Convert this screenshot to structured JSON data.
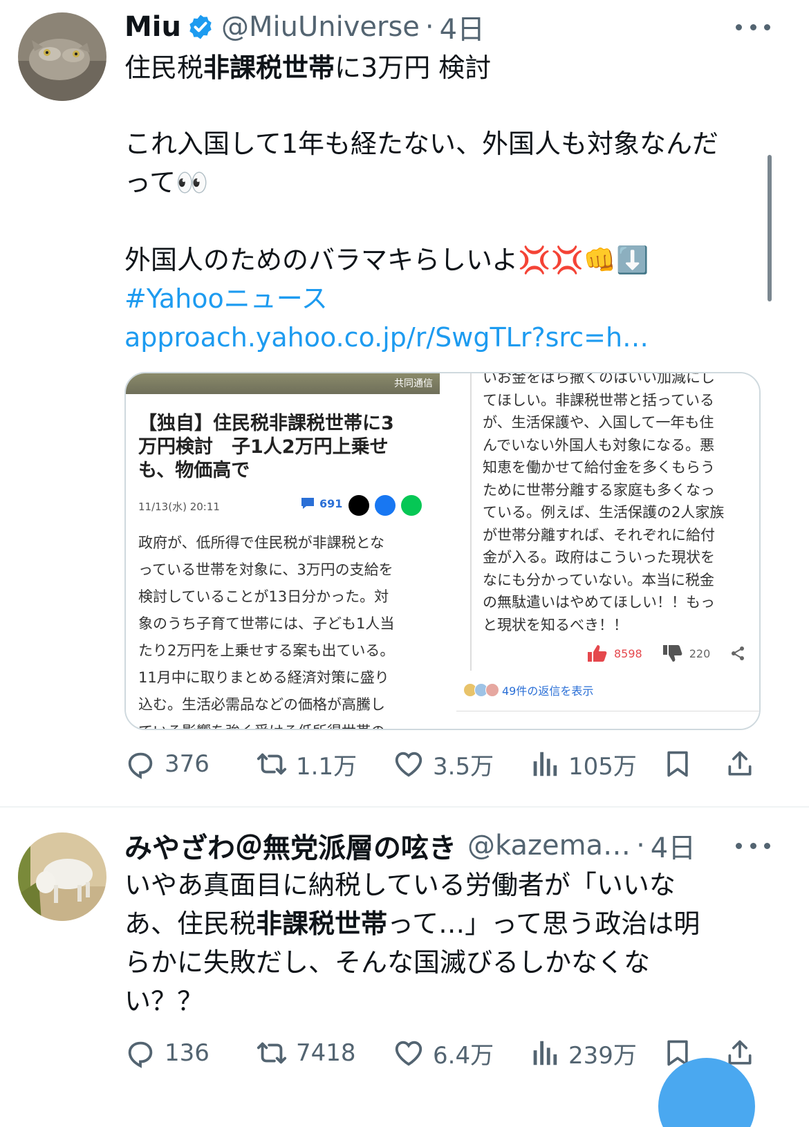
{
  "tweet1": {
    "author_name": "Miu",
    "handle": "@MiuUniverse",
    "separator": "·",
    "time": "4日",
    "text_line1_pre": "住民税",
    "text_line1_bold": "非課税世帯",
    "text_line1_post": "に3万円 検討",
    "text_line2": "これ入国して1年も経たない、外国人も対象なんだ",
    "text_line3": "って👀",
    "text_line4": "外国人のためのバラマキらしいよ💢💢👊⬇️",
    "hashtag": "#Yahooニュース",
    "url": "approach.yahoo.co.jp/r/SwgTLr?src=h…",
    "media": {
      "photo_caption": "共同通信",
      "article_title_lines": [
        "【独自】住民税非課税世帯に3",
        "万円検討　子1人2万円上乗せ",
        "も、物価高で"
      ],
      "article_date": "11/13(水) 20:11",
      "article_comments": "691",
      "article_body_lines": [
        "政府が、低所得で住民税が非課税とな",
        "っている世帯を対象に、3万円の支給を",
        "検討していることが13日分かった。対",
        "象のうち子育て世帯には、子ども1人当",
        "たり2万円を上乗せする案も出ている。",
        "11月中に取りまとめる経済対策に盛り",
        "込む。生活必需品などの価格が高騰し",
        "ている影響を強く受ける低所得世帯の"
      ],
      "comment_lines": [
        "いお金をばら撒くのはいい加減にし",
        "てほしい。非課税世帯と括っている",
        "が、生活保護や、入国して一年も住",
        "んでいない外国人も対象になる。悪",
        "知恵を働かせて給付金を多くもらう",
        "ために世帯分離する家庭も多くなっ",
        "ている。例えば、生活保護の2人家族",
        "が世帯分離すれば、それぞれに給付",
        "金が入る。政府はこういった現状を",
        "なにも分かっていない。本当に税金",
        "の無駄遣いはやめてほしい！！もっ",
        "と現状を知るべき！！"
      ],
      "comment_likes": "8598",
      "comment_dislikes": "220",
      "comment_replies": "49件の返信を表示"
    },
    "stats": {
      "replies": "376",
      "retweets": "1.1万",
      "likes": "3.5万",
      "views": "105万"
    }
  },
  "tweet2": {
    "author_name": "みやざわ＠無党派層の呟き",
    "handle": "@kazema…",
    "separator": "·",
    "time": "4日",
    "line1": "いやあ真面目に納税している労働者が「いいな",
    "line2_pre": "あ、住民税",
    "line2_bold": "非課税世帯",
    "line2_post": "って…」って思う政治は明",
    "line3": "らかに失敗だし、そんな国滅びるしかなくな",
    "line4": "い？？",
    "stats": {
      "replies": "136",
      "retweets": "7418",
      "likes": "6.4万",
      "views": "239万"
    }
  },
  "colors": {
    "accent": "#1d9bf0",
    "secondary_text": "#536471",
    "primary_text": "#0f1419"
  },
  "icons": [
    "verified-badge-icon",
    "more-icon",
    "reply-icon",
    "retweet-icon",
    "like-icon",
    "views-icon",
    "bookmark-icon",
    "share-icon"
  ]
}
